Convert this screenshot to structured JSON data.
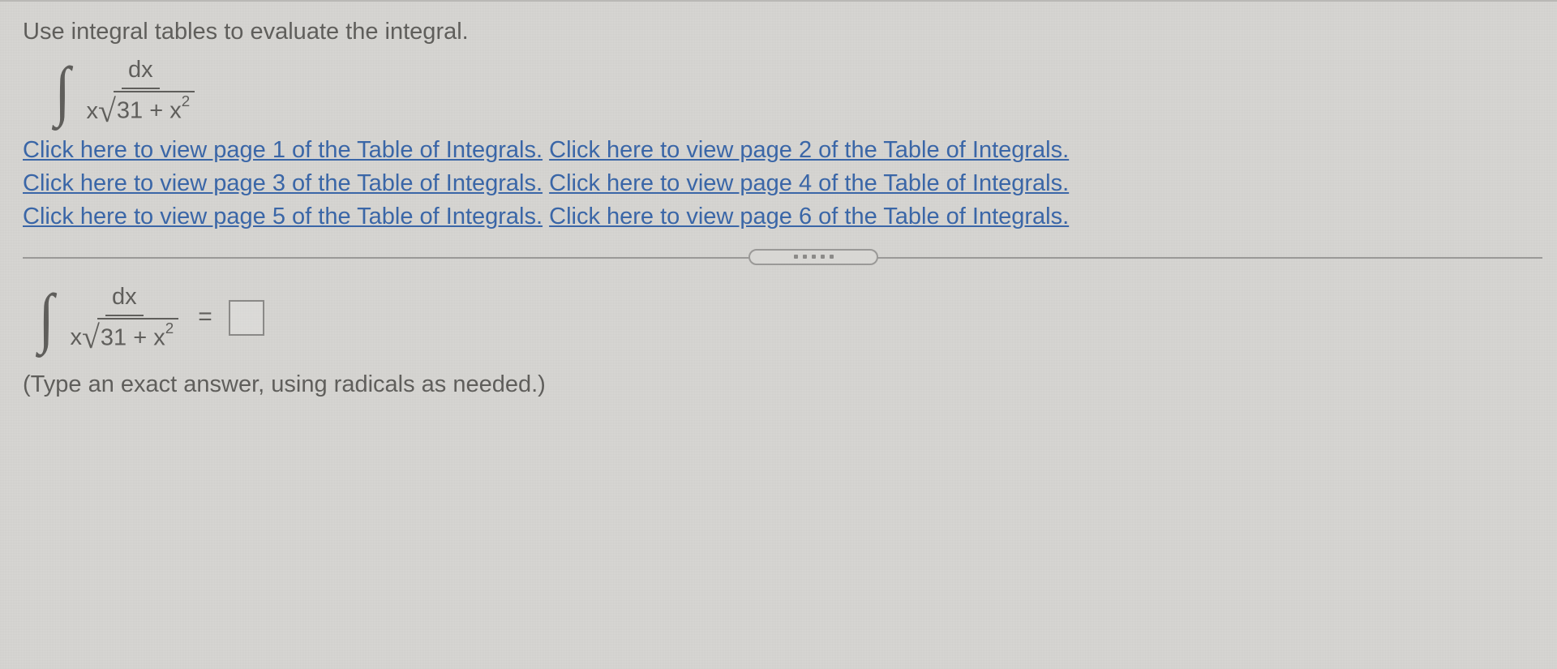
{
  "prompt": "Use integral tables to evaluate the integral.",
  "integral": {
    "numerator": "dx",
    "den_prefix": "x",
    "radicand": "31 + x",
    "exponent": "2"
  },
  "links": {
    "p1": "Click here to view page 1 of the Table of Integrals.",
    "p2": "Click here to view page 2 of the Table of Integrals.",
    "p3": "Click here to view page 3 of the Table of Integrals.",
    "p4": "Click here to view page 4 of the Table of Integrals.",
    "p5": "Click here to view page 5 of the Table of Integrals.",
    "p6": "Click here to view page 6 of the Table of Integrals."
  },
  "equals": "=",
  "answer_value": "",
  "hint": "(Type an exact answer, using radicals as needed.)"
}
